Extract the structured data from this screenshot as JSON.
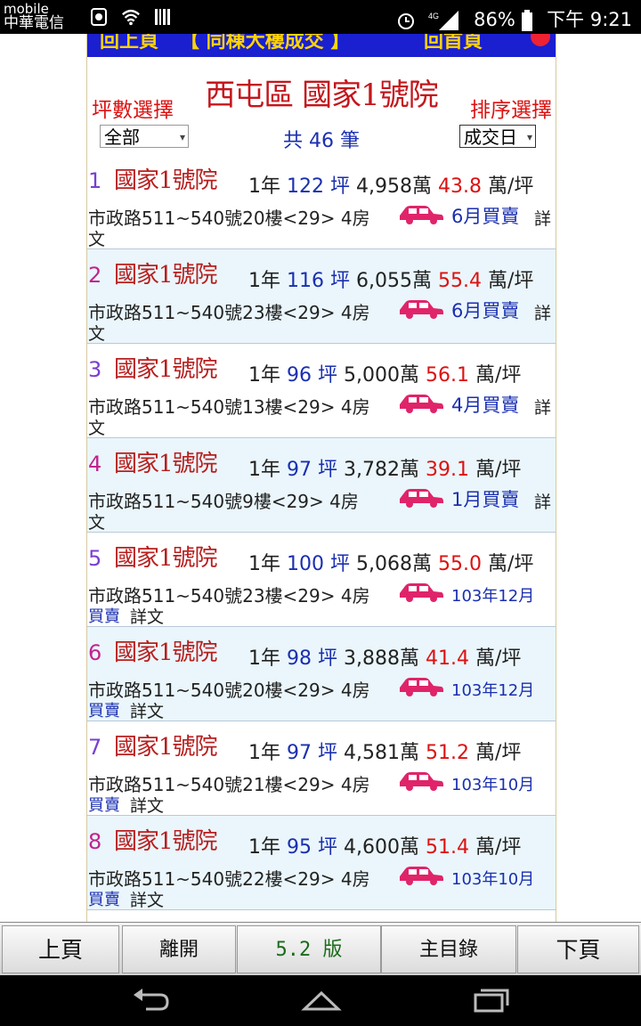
{
  "status": {
    "carrier_top": "mobile",
    "carrier_bottom": "中華電信",
    "battery": "86%",
    "time": "下午 9:21"
  },
  "topnav": {
    "prev": "回上頁",
    "mid": "【 同棟大樓成交 】",
    "home": "回首頁"
  },
  "header": {
    "title": "西屯區 國家1號院",
    "area_label": "坪數選擇",
    "sort_label": "排序選擇",
    "area_value": "全部",
    "sort_value": "成交日",
    "count_text": "共 46 筆"
  },
  "colors": {
    "accent": "#1a2fb0",
    "price": "#d11111",
    "car": "#e0246a",
    "num_odd": "#7a3fd0",
    "num_even": "#c0238f"
  },
  "records": [
    {
      "num": "1",
      "name": "國家1號院",
      "age": "1年",
      "ping": "122",
      "unit": "坪",
      "total": "4,958萬",
      "price": "43.8",
      "price_unit": "萬/坪",
      "address": "市政路511~540號20樓<29> 4房",
      "month": "6月買賣",
      "detail": "詳",
      "wen": "文"
    },
    {
      "num": "2",
      "name": "國家1號院",
      "age": "1年",
      "ping": "116",
      "unit": "坪",
      "total": "6,055萬",
      "price": "55.4",
      "price_unit": "萬/坪",
      "address": "市政路511~540號23樓<29> 4房",
      "month": "6月買賣",
      "detail": "詳",
      "wen": "文"
    },
    {
      "num": "3",
      "name": "國家1號院",
      "age": "1年",
      "ping": "96",
      "unit": "坪",
      "total": "5,000萬",
      "price": "56.1",
      "price_unit": "萬/坪",
      "address": "市政路511~540號13樓<29> 4房",
      "month": "4月買賣",
      "detail": "詳",
      "wen": "文"
    },
    {
      "num": "4",
      "name": "國家1號院",
      "age": "1年",
      "ping": "97",
      "unit": "坪",
      "total": "3,782萬",
      "price": "39.1",
      "price_unit": "萬/坪",
      "address": "市政路511~540號9樓<29> 4房",
      "month": "1月買賣",
      "detail": "詳",
      "wen": "文"
    },
    {
      "num": "5",
      "name": "國家1號院",
      "age": "1年",
      "ping": "100",
      "unit": "坪",
      "total": "5,068萬",
      "price": "55.0",
      "price_unit": "萬/坪",
      "address": "市政路511~540號23樓<29> 4房",
      "month": "103年12月",
      "detail": "詳文",
      "wen": "買賣"
    },
    {
      "num": "6",
      "name": "國家1號院",
      "age": "1年",
      "ping": "98",
      "unit": "坪",
      "total": "3,888萬",
      "price": "41.4",
      "price_unit": "萬/坪",
      "address": "市政路511~540號20樓<29> 4房",
      "month": "103年12月",
      "detail": "詳文",
      "wen": "買賣"
    },
    {
      "num": "7",
      "name": "國家1號院",
      "age": "1年",
      "ping": "97",
      "unit": "坪",
      "total": "4,581萬",
      "price": "51.2",
      "price_unit": "萬/坪",
      "address": "市政路511~540號21樓<29> 4房",
      "month": "103年10月",
      "detail": "詳文",
      "wen": "買賣"
    },
    {
      "num": "8",
      "name": "國家1號院",
      "age": "1年",
      "ping": "95",
      "unit": "坪",
      "total": "4,600萬",
      "price": "51.4",
      "price_unit": "萬/坪",
      "address": "市政路511~540號22樓<29> 4房",
      "month": "103年10月",
      "detail": "詳文",
      "wen": "買賣"
    }
  ],
  "bottombar": {
    "prev": "上頁",
    "leave": "離開",
    "version": "5.2 版",
    "menu": "主目錄",
    "next": "下頁"
  },
  "icons": {
    "wifi": "wifi-icon",
    "signal": "signal-icon",
    "battery": "battery-icon",
    "alarm": "alarm-icon",
    "car": "car-icon",
    "back": "back-icon",
    "home": "home-icon",
    "recent": "recent-apps-icon"
  }
}
